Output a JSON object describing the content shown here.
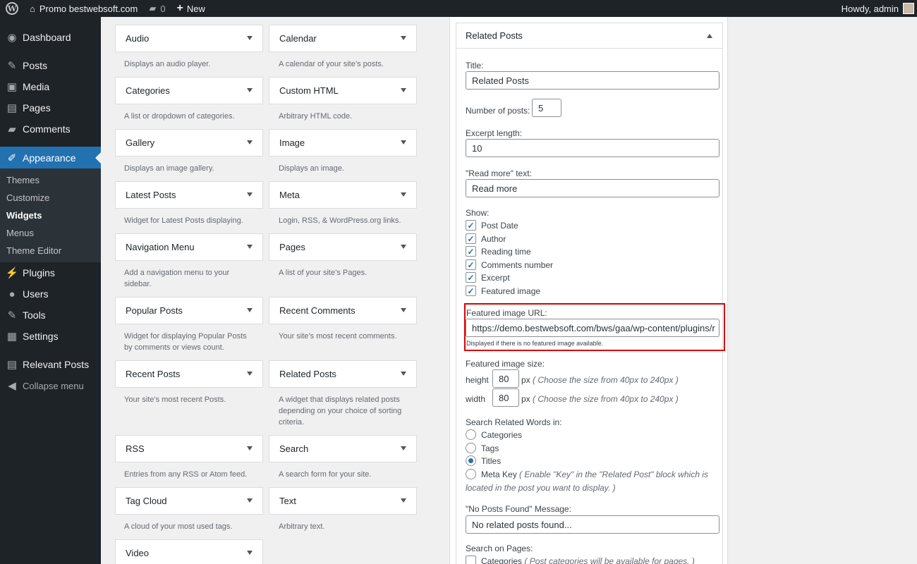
{
  "adminbar": {
    "site_name": "Promo bestwebsoft.com",
    "comments_count": "0",
    "new_label": "New",
    "howdy": "Howdy, admin"
  },
  "sidebar": {
    "items": [
      {
        "label": "Dashboard",
        "icon": "dashboard-icon"
      },
      {
        "label": "Posts",
        "icon": "pin-icon"
      },
      {
        "label": "Media",
        "icon": "media-icon"
      },
      {
        "label": "Pages",
        "icon": "pages-icon"
      },
      {
        "label": "Comments",
        "icon": "comment-icon"
      },
      {
        "label": "Appearance",
        "icon": "brush-icon"
      }
    ],
    "submenu": [
      "Themes",
      "Customize",
      "Widgets",
      "Menus",
      "Theme Editor"
    ],
    "items2": [
      {
        "label": "Plugins",
        "icon": "plug-icon"
      },
      {
        "label": "Users",
        "icon": "user-icon"
      },
      {
        "label": "Tools",
        "icon": "wrench-icon"
      },
      {
        "label": "Settings",
        "icon": "settings-icon"
      },
      {
        "label": "Relevant Posts",
        "icon": "relevant-icon"
      }
    ],
    "collapse": "Collapse menu"
  },
  "widgets": [
    {
      "name": "Audio",
      "desc": "Displays an audio player."
    },
    {
      "name": "Calendar",
      "desc": "A calendar of your site’s posts."
    },
    {
      "name": "Categories",
      "desc": "A list or dropdown of categories."
    },
    {
      "name": "Custom HTML",
      "desc": "Arbitrary HTML code."
    },
    {
      "name": "Gallery",
      "desc": "Displays an image gallery."
    },
    {
      "name": "Image",
      "desc": "Displays an image."
    },
    {
      "name": "Latest Posts",
      "desc": "Widget for Latest Posts displaying."
    },
    {
      "name": "Meta",
      "desc": "Login, RSS, & WordPress.org links."
    },
    {
      "name": "Navigation Menu",
      "desc": "Add a navigation menu to your sidebar."
    },
    {
      "name": "Pages",
      "desc": "A list of your site’s Pages."
    },
    {
      "name": "Popular Posts",
      "desc": "Widget for displaying Popular Posts by comments or views count."
    },
    {
      "name": "Recent Comments",
      "desc": "Your site’s most recent comments."
    },
    {
      "name": "Recent Posts",
      "desc": "Your site’s most recent Posts."
    },
    {
      "name": "Related Posts",
      "desc": "A widget that displays related posts depending on your choice of sorting criteria."
    },
    {
      "name": "RSS",
      "desc": "Entries from any RSS or Atom feed."
    },
    {
      "name": "Search",
      "desc": "A search form for your site."
    },
    {
      "name": "Tag Cloud",
      "desc": "A cloud of your most used tags."
    },
    {
      "name": "Text",
      "desc": "Arbitrary text."
    },
    {
      "name": "Video",
      "desc": ""
    }
  ],
  "panel": {
    "header": "Related Posts",
    "title_label": "Title:",
    "title_value": "Related Posts",
    "num_posts_label": "Number of posts:",
    "num_posts_value": "5",
    "excerpt_label": "Excerpt length:",
    "excerpt_value": "10",
    "readmore_label": "\"Read more\" text:",
    "readmore_value": "Read more",
    "show_label": "Show:",
    "show_options": [
      "Post Date",
      "Author",
      "Reading time",
      "Comments number",
      "Excerpt",
      "Featured image"
    ],
    "feat_url_label": "Featured image URL:",
    "feat_url_value": "https://demo.bestwebsoft.com/bws/gaa/wp-content/plugins/r",
    "feat_url_note": "Displayed if there is no featured image available.",
    "feat_size_label": "Featured image size:",
    "height_label": "height",
    "height_value": "80",
    "width_label": "width",
    "width_value": "80",
    "px": "px",
    "size_hint": "( Choose the size from 40px to 240px )",
    "search_label": "Search Related Words in:",
    "search_options": [
      "Categories",
      "Tags",
      "Titles",
      "Meta Key"
    ],
    "metakey_hint_line1": "( Enable \"Key\" in the \"Related Post\" block which is",
    "metakey_hint_line2": "located in the post you want to display. )",
    "noposts_label": "\"No Posts Found\" Message:",
    "noposts_value": "No related posts found...",
    "search_pages_label": "Search on Pages:",
    "pages_categories": "Categories",
    "pages_categories_hint": "( Post categories will be available for pages. )"
  }
}
